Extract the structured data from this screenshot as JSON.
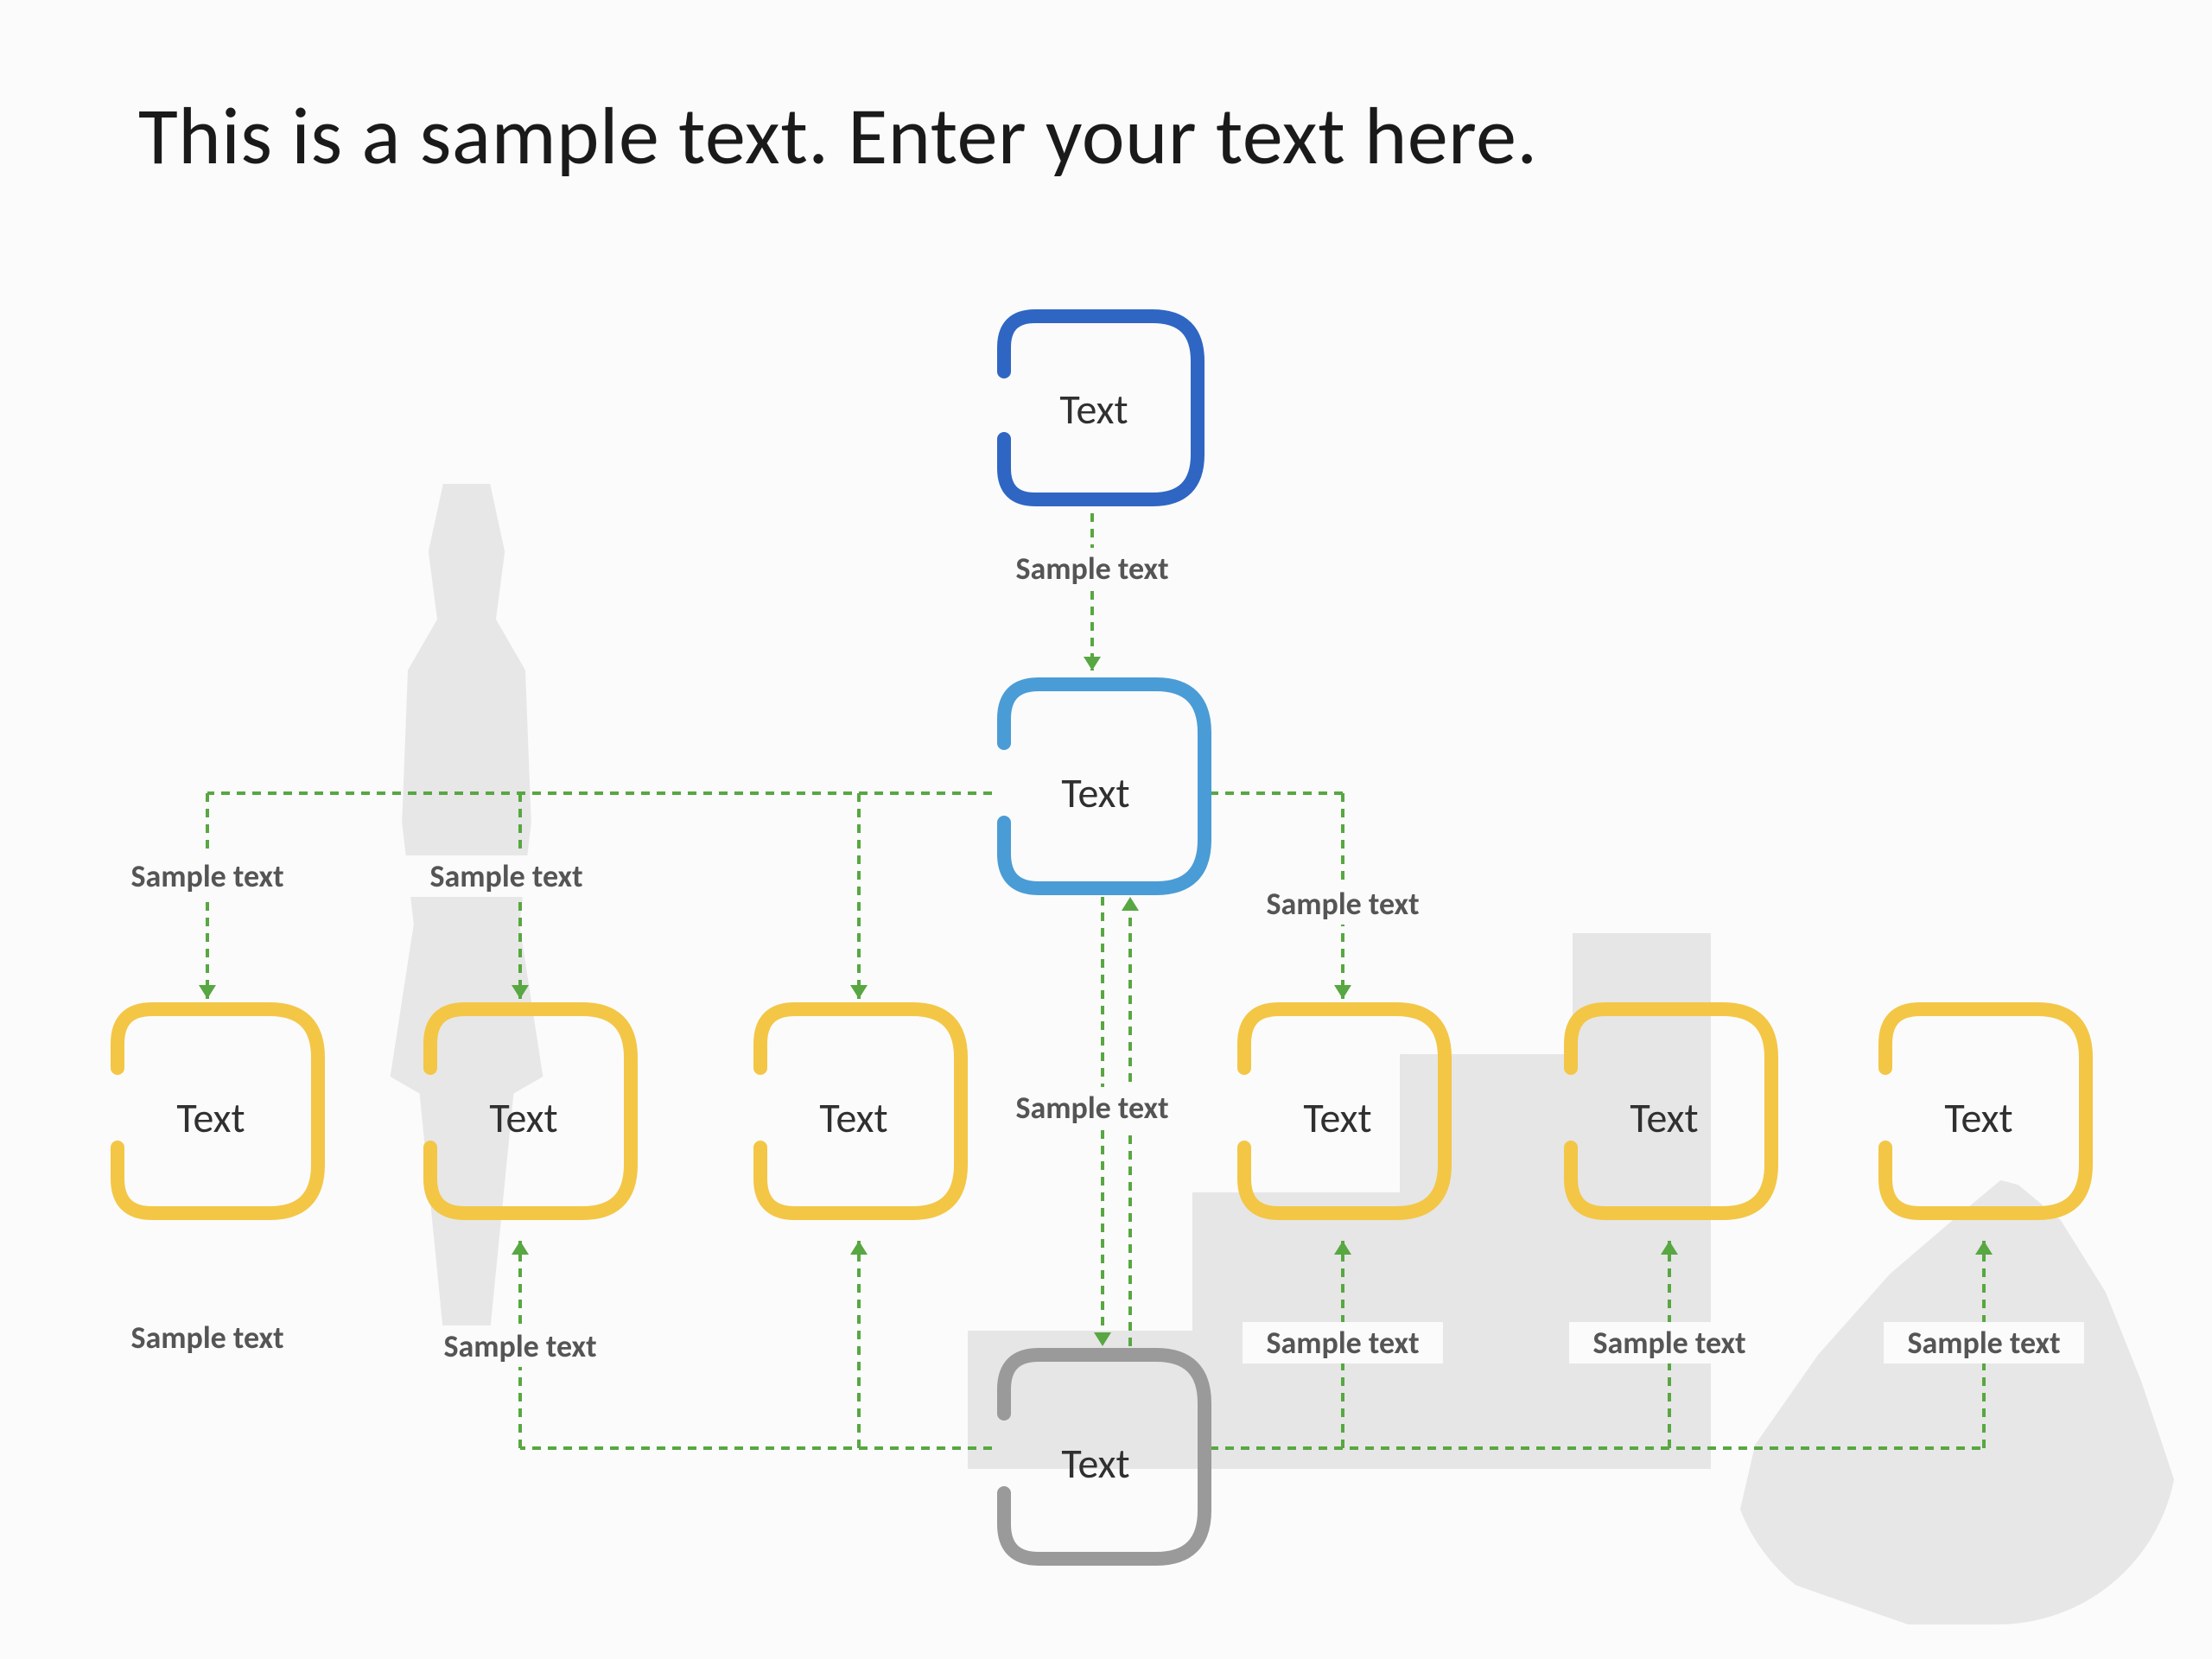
{
  "title": "This is a sample text. Enter your text here.",
  "nodes": {
    "top": "Text",
    "mid": "Text",
    "row": [
      "Text",
      "Text",
      "Text",
      "Text",
      "Text",
      "Text"
    ],
    "bottom": "Text"
  },
  "labels": {
    "top_to_mid": "Sample text",
    "mid_to_row": [
      "Sample text",
      "Sample text",
      "Sample text",
      "Sample text"
    ],
    "bottom_to_row": [
      "Sample text",
      "Sample text",
      "Sample text",
      "Sample text",
      "Sample text"
    ]
  },
  "colors": {
    "blue": "#2f66c4",
    "lblue": "#4a9cd6",
    "yellow": "#f3c646",
    "gray": "#9a9a9a",
    "connector": "#58a742"
  }
}
